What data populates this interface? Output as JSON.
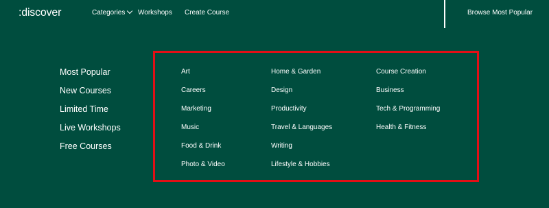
{
  "header": {
    "logo": ":discover",
    "nav": {
      "categories": "Categories",
      "workshops": "Workshops",
      "create_course": "Create Course",
      "browse_most_popular": "Browse Most Popular"
    }
  },
  "sidebar": {
    "items": [
      {
        "label": "Most Popular"
      },
      {
        "label": "New Courses"
      },
      {
        "label": "Limited Time"
      },
      {
        "label": "Live Workshops"
      },
      {
        "label": "Free Courses"
      }
    ]
  },
  "categories_menu": {
    "columns": [
      {
        "items": [
          {
            "label": "Art"
          },
          {
            "label": "Careers"
          },
          {
            "label": "Marketing"
          },
          {
            "label": "Music"
          },
          {
            "label": "Food & Drink"
          },
          {
            "label": "Photo & Video"
          }
        ]
      },
      {
        "items": [
          {
            "label": "Home & Garden"
          },
          {
            "label": "Design"
          },
          {
            "label": "Productivity"
          },
          {
            "label": "Travel & Languages"
          },
          {
            "label": "Writing"
          },
          {
            "label": "Lifestyle & Hobbies"
          }
        ]
      },
      {
        "items": [
          {
            "label": "Course Creation"
          },
          {
            "label": "Business"
          },
          {
            "label": "Tech & Programming"
          },
          {
            "label": "Health & Fitness"
          }
        ]
      }
    ]
  },
  "icons": {
    "categories_dropdown": "chevron-down-icon"
  },
  "colors": {
    "background": "#004d3e",
    "text": "#ffffff",
    "highlight_border": "#e30f16"
  }
}
